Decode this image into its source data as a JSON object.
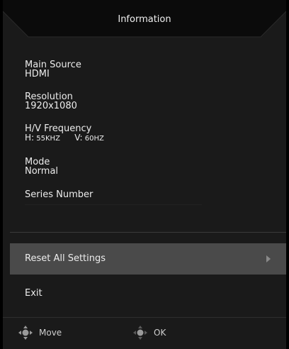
{
  "window": {
    "title": "Information"
  },
  "info": {
    "main_source_label": "Main Source",
    "main_source_value": "HDMI",
    "resolution_label": "Resolution",
    "resolution_value": "1920x1080",
    "frequency_label": "H/V Frequency",
    "h_key": "H:",
    "h_value": "55KHZ",
    "v_key": "V:",
    "v_value": "60HZ",
    "mode_label": "Mode",
    "mode_value": "Normal",
    "series_label": "Series Number",
    "series_value": ""
  },
  "menu": {
    "reset_label": "Reset All Settings",
    "exit_label": "Exit"
  },
  "footer": {
    "move_label": "Move",
    "ok_label": "OK"
  },
  "colors": {
    "panel_bg": "#1a1a1a",
    "selected_bg": "#4a4a4a",
    "title_bar_bg": "#0d0d0d"
  }
}
